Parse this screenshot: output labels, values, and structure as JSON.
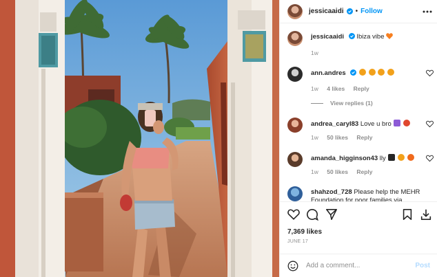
{
  "header": {
    "username": "jessicaaidi",
    "separator": "•",
    "follow_label": "Follow",
    "more_icon": "more-horizontal-icon"
  },
  "caption": {
    "username": "jessicaaidi",
    "text": "Ibiza vibe",
    "age": "1w"
  },
  "comments": [
    {
      "username": "ann.andres",
      "text": "",
      "emoji_count": 4,
      "age": "1w",
      "likes": "4 likes",
      "reply_label": "Reply",
      "verified": true
    },
    {
      "username": "andrea_caryl83",
      "text": "Love u bro",
      "age": "1w",
      "likes": "50 likes",
      "reply_label": "Reply"
    },
    {
      "username": "amanda_higginson43",
      "text": "lly",
      "age": "1w",
      "likes": "50 likes",
      "reply_label": "Reply"
    },
    {
      "username": "shahzod_728",
      "text": "Please help the MEHR Foundation for poor families via",
      "age": "",
      "likes": "",
      "reply_label": ""
    }
  ],
  "view_replies": "View replies (1)",
  "actions": {
    "icons": [
      "heart-icon",
      "comment-icon",
      "share-icon",
      "bookmark-icon",
      "download-icon"
    ],
    "likes_count": "7,369 likes",
    "date": "JUNE 17"
  },
  "add_comment": {
    "placeholder": "Add a comment...",
    "post_label": "Post"
  },
  "colors": {
    "accent": "#0095f6",
    "post_disabled": "#b3dbff",
    "muted": "#8e8e8e"
  }
}
